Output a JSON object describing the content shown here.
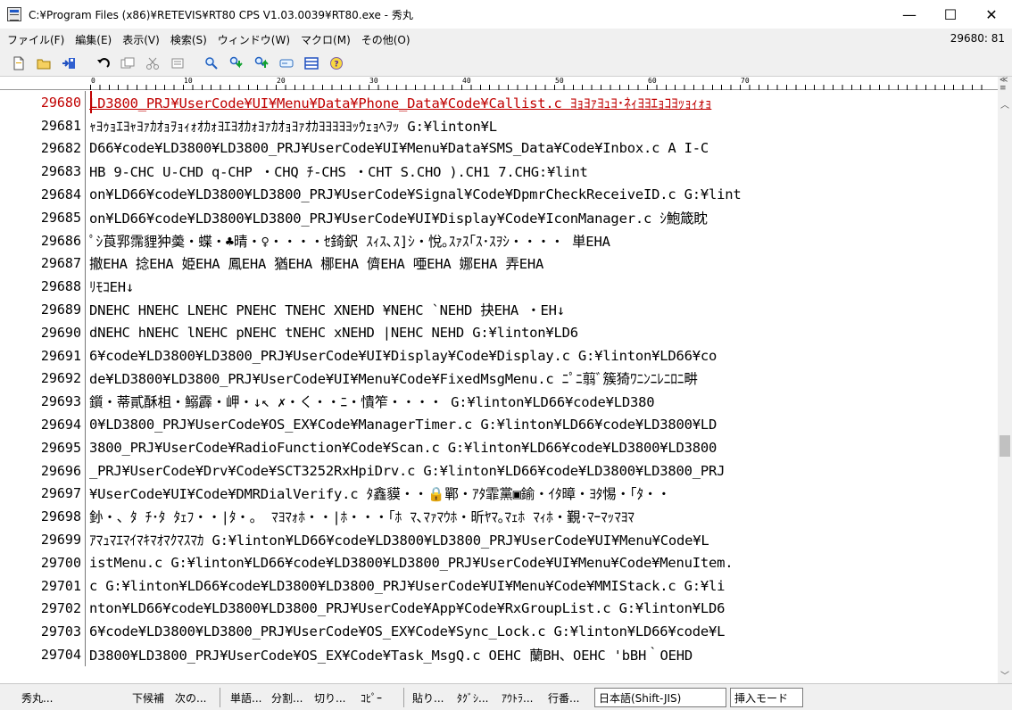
{
  "window": {
    "title": "C:¥Program Files (x86)¥RETEVIS¥RT80 CPS V1.03.0039¥RT80.exe - 秀丸",
    "minimize": "—",
    "maximize": "☐",
    "close": "✕"
  },
  "menu": {
    "items": [
      "ファイル(F)",
      "編集(E)",
      "表示(V)",
      "検索(S)",
      "ウィンドウ(W)",
      "マクロ(M)",
      "その他(O)"
    ],
    "cursor_position": "29680: 81"
  },
  "toolbar": {
    "icons": [
      "new-file-icon",
      "open-folder-icon",
      "save-icon",
      "undo-icon",
      "copy-icon",
      "cut-icon",
      "paste-icon",
      "search-icon",
      "search-next-icon",
      "search-prev-icon",
      "grep-icon",
      "window-split-icon",
      "help-icon"
    ]
  },
  "ruler": {
    "marks": [
      "0",
      "10",
      "20",
      "30",
      "40",
      "50",
      "60",
      "70"
    ]
  },
  "editor": {
    "lines": [
      {
        "no": "29680",
        "text": "LD3800_PRJ¥UserCode¥UI¥Menu¥Data¥Phone_Data¥Code¥Callist.c  ﾖｮﾖｧﾖｭﾖ･ﾈｨﾖﾖｴｮｺﾖｯｮｨｫｮ"
      },
      {
        "no": "29681",
        "text": "ｬﾖｩｮｴﾖｬﾖｧｶｵｮｦｮｨｫｵｶｫﾖｴﾖｵｶｫﾖｧｶｵｮﾖｧｵｶﾖﾖﾖﾖﾖｯｳｪｮﾍｦｯ  G:¥linton¥L"
      },
      {
        "no": "29682",
        "text": "D66¥code¥LD3800¥LD3800_PRJ¥UserCode¥UI¥Menu¥Data¥SMS_Data¥Code¥Inbox.c   A   I-C"
      },
      {
        "no": "29683",
        "text": "HB   9-CHC   U-CHD   q-CHP    ・CHQ   ﾁ-CHS    ・CHT   S.CHO   ).CH1   7.CHG:¥lint"
      },
      {
        "no": "29684",
        "text": "on¥LD66¥code¥LD3800¥LD3800_PRJ¥UserCode¥Signal¥Code¥DpmrCheckReceiveID.c G:¥lint"
      },
      {
        "no": "29685",
        "text": "on¥LD66¥code¥LD3800¥LD3800_PRJ¥UserCode¥UI¥Display¥Code¥IconManager.c   ｼ鮑箴眈"
      },
      {
        "no": "29686",
        "text": "ﾟｼ莨郛霈貍狆羮・蝶・♣晴・♀・・・・ｾ錡鈬 ｽｨｽ､ｽ]ｼ・悅｡ｽｧｽ｢ｽ･ｽｦｼ・・・・  単EHA"
      },
      {
        "no": "29687",
        "text": " 撤EHA   捻EHA   姫EHA   鳳EHA   猶EHA   梛EHA   儕EHA   唖EHA   娜EHA   弄EHA"
      },
      {
        "no": "29688",
        "text": "ﾘﾓｺEH↓"
      },
      {
        "no": "29689",
        "text": "   DNEHC   HNEHC   LNEHC   PNEHC   TNEHC   XNEHD   ¥NEHC   `NEHD   抉EHA    ・EH↓"
      },
      {
        "no": "29690",
        "text": "   dNEHC   hNEHC   lNEHC   pNEHC   tNEHC   xNEHD   |NEHC   NEHD   G:¥linton¥LD6"
      },
      {
        "no": "29691",
        "text": "6¥code¥LD3800¥LD3800_PRJ¥UserCode¥UI¥Display¥Code¥Display.c    G:¥linton¥LD66¥co"
      },
      {
        "no": "29692",
        "text": "de¥LD3800¥LD3800_PRJ¥UserCode¥UI¥Menu¥Code¥FixedMsgMenu.c  ﾆﾟﾆ翦ﾞ簇猗ﾜﾆﾝﾆﾚﾆﾛﾆ畊"
      },
      {
        "no": "29693",
        "text": "鑕・蒂貳酥柤・鰯霹・岬・↓↖ ✗・く・・ﾆ・憒笮・・・・   G:¥linton¥LD66¥code¥LD380"
      },
      {
        "no": "29694",
        "text": "0¥LD3800_PRJ¥UserCode¥OS_EX¥Code¥ManagerTimer.c    G:¥linton¥LD66¥code¥LD3800¥LD"
      },
      {
        "no": "29695",
        "text": "3800_PRJ¥UserCode¥RadioFunction¥Code¥Scan.c    G:¥linton¥LD66¥code¥LD3800¥LD3800"
      },
      {
        "no": "29696",
        "text": "_PRJ¥UserCode¥Drv¥Code¥SCT3252RxHpiDrv.c    G:¥linton¥LD66¥code¥LD3800¥LD3800_PRJ"
      },
      {
        "no": "29697",
        "text": "¥UserCode¥UI¥Code¥DMRDialVerify.c  ﾀ鑫貘・・🔒鄲・ｱﾀ霏黨▣鍮・ｲﾀ暲・ﾖﾀ惕・｢ﾀ・・"
      },
      {
        "no": "29698",
        "text": "釥・、ﾀ ﾁ･ﾀ ﾀｪﾌ・・|ﾀ・。   ﾏﾖﾏｫﾎ・・|ﾎ・・・｢ﾎ ﾏ､ﾏｧﾏｳﾎ・昕ﾔﾏ｡ﾏｪﾎ ﾏｨﾎ・覲･ﾏｰﾏｯﾏﾖﾏ"
      },
      {
        "no": "29699",
        "text": "ｱﾏｭﾏｴﾏｲﾏｷﾏｵﾏｸﾏｽﾏｶ   G:¥linton¥LD66¥code¥LD3800¥LD3800_PRJ¥UserCode¥UI¥Menu¥Code¥L"
      },
      {
        "no": "29700",
        "text": "istMenu.c  G:¥linton¥LD66¥code¥LD3800¥LD3800_PRJ¥UserCode¥UI¥Menu¥Code¥MenuItem."
      },
      {
        "no": "29701",
        "text": "c  G:¥linton¥LD66¥code¥LD3800¥LD3800_PRJ¥UserCode¥UI¥Menu¥Code¥MMIStack.c  G:¥li"
      },
      {
        "no": "29702",
        "text": "nton¥LD66¥code¥LD3800¥LD3800_PRJ¥UserCode¥App¥Code¥RxGroupList.c   G:¥linton¥LD6"
      },
      {
        "no": "29703",
        "text": "6¥code¥LD3800¥LD3800_PRJ¥UserCode¥OS_EX¥Code¥Sync_Lock.c   G:¥linton¥LD66¥code¥L"
      },
      {
        "no": "29704",
        "text": "D3800¥LD3800_PRJ¥UserCode¥OS_EX¥Code¥Task_MsgQ.c    OEHC   蘭BH、OEHC   'bBH｀OEHD"
      }
    ]
  },
  "statusbar": {
    "app": "秀丸...",
    "candidates": "下候補",
    "next": "次の...",
    "word": "単語...",
    "split": "分割...",
    "cut": "切り...",
    "copy": "ｺﾋﾟｰ",
    "paste": "貼り...",
    "tag": "ﾀｸﾞｼ...",
    "outline": "ｱｳﾄﾗ...",
    "line_number": "行番...",
    "encoding": "日本語(Shift-JIS)",
    "mode": "挿入モード"
  }
}
